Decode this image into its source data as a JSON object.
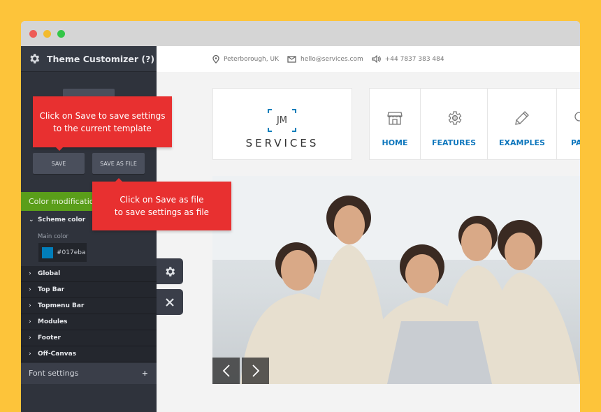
{
  "colors": {
    "background": "#fdc43a",
    "accent": "#017eba",
    "tooltip": "#e83030",
    "green": "#5a9e1a"
  },
  "customizer": {
    "title": "Theme Customizer (?)",
    "save_label": "SAVE",
    "save_as_file_label": "SAVE AS FILE",
    "tooltip_save": [
      "Click on Save to save settings",
      "to the current template"
    ],
    "tooltip_save_file": [
      "Click on Save as file",
      "to save settings as file"
    ],
    "section": "Color modifications",
    "scheme": "Scheme color",
    "main_color_label": "Main color",
    "main_color_value": "#017eba",
    "items": [
      "Global",
      "Top Bar",
      "Topmenu Bar",
      "Modules",
      "Footer",
      "Off-Canvas"
    ],
    "font_settings": "Font settings",
    "font_settings_icon": "+"
  },
  "site": {
    "topbar": {
      "location": "Peterborough, UK",
      "email": "hello@services.com",
      "phone": "+44 7837 383 484"
    },
    "logo": {
      "mark": "JM",
      "name": "SERVICES"
    },
    "nav": [
      {
        "label": "HOME",
        "icon": "store-icon"
      },
      {
        "label": "FEATURES",
        "icon": "gear-icon"
      },
      {
        "label": "EXAMPLES",
        "icon": "pencil-icon"
      },
      {
        "label": "PA",
        "icon": "bulb-icon"
      }
    ]
  }
}
